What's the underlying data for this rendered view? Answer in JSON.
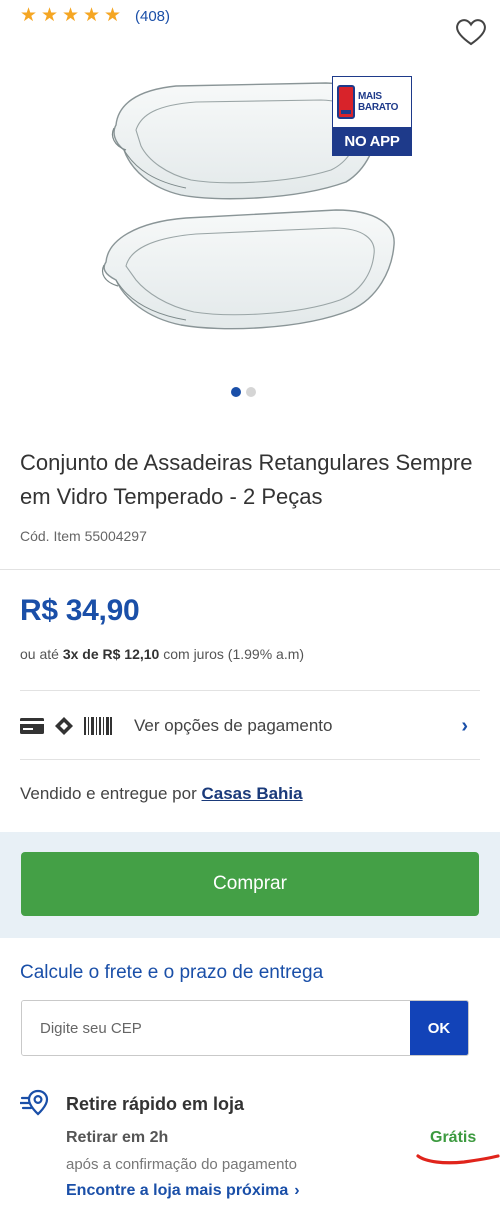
{
  "rating": {
    "stars": 5,
    "count": "(408)"
  },
  "favorite": {
    "icon": "heart-outline-icon"
  },
  "badge": {
    "line1": "MAIS",
    "line2": "BARATO",
    "bottom": "NO APP"
  },
  "carousel": {
    "total": 2,
    "active": 1
  },
  "product": {
    "title": "Conjunto de Assadeiras Retangulares Sempre em Vidro Temperado - 2 Peças",
    "code": "Cód. Item 55004297",
    "price": "R$ 34,90",
    "installments_prefix": "ou até",
    "installments_bold": "3x de R$ 12,10",
    "installments_suffix": "com juros (1.99% a.m)"
  },
  "payment": {
    "label": "Ver opções de pagamento"
  },
  "seller": {
    "prefix": "Vendido e entregue por",
    "name": "Casas Bahia"
  },
  "buy": {
    "label": "Comprar"
  },
  "freight": {
    "title": "Calcule o frete e o prazo de entrega",
    "cep_placeholder": "Digite seu CEP",
    "ok_label": "OK"
  },
  "pickup": {
    "title": "Retire rápido em loja",
    "time": "Retirar em 2h",
    "price": "Grátis",
    "note": "após a confirmação do pagamento",
    "link": "Encontre a loja mais próxima"
  },
  "colors": {
    "brand_blue": "#1a4fa8",
    "buy_green": "#44a046",
    "free_green": "#3c9a3f"
  }
}
